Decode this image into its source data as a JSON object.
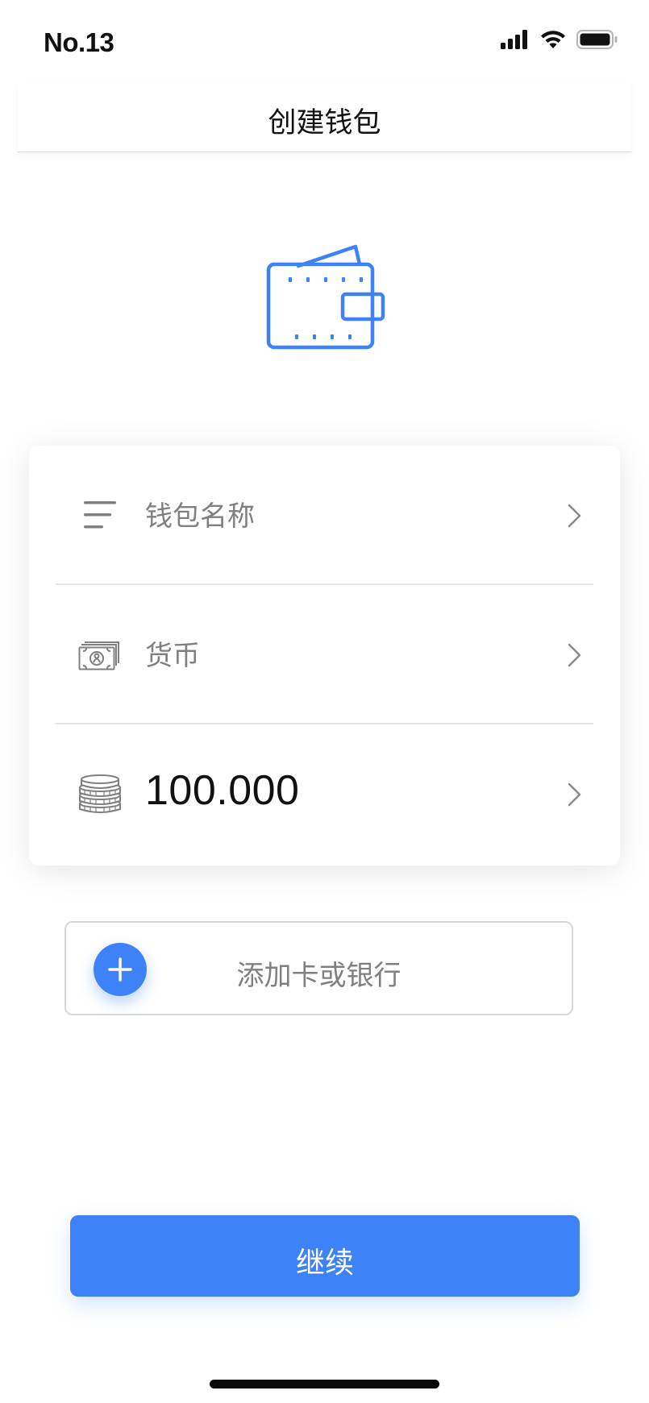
{
  "status_bar": {
    "carrier": "No.13",
    "signal_icon": "cellular-signal-icon",
    "wifi_icon": "wifi-icon",
    "battery_icon": "battery-icon"
  },
  "header": {
    "title": "创建钱包"
  },
  "illustration": {
    "icon": "wallet-icon",
    "color": "#3e82f7"
  },
  "form": {
    "rows": [
      {
        "icon": "menu-lines-icon",
        "label": "钱包名称",
        "chevron": "chevron-right-icon"
      },
      {
        "icon": "banknote-icon",
        "label": "货币",
        "chevron": "chevron-right-icon"
      },
      {
        "icon": "coin-stack-icon",
        "value": "100.000",
        "chevron": "chevron-right-icon"
      }
    ]
  },
  "add_card": {
    "label": "添加卡或银行",
    "icon": "plus-icon"
  },
  "continue_button": {
    "label": "继续"
  },
  "colors": {
    "accent": "#3e82f7",
    "muted_text": "#808080",
    "divider": "#e6e6e6"
  }
}
